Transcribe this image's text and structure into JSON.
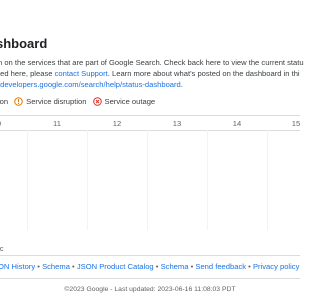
{
  "page": {
    "title": "shboard",
    "intro_line1_prefix": "n on the services that are part of Google Search. Check back here to view the current statu",
    "intro_line2_prefix": "ted here, please ",
    "contact_support_link": "contact Support",
    "intro_line2_suffix": ". Learn more about what's posted on the dashboard in thi",
    "status_dashboard_link": "/developers.google.com/search/help/status-dashboard",
    "intro_line3_suffix": "."
  },
  "legend": {
    "items": [
      {
        "label": "ion",
        "icon": "info-icon",
        "color": "#5f6368"
      },
      {
        "label": "Service disruption",
        "icon": "warning-circle-icon",
        "color": "#e37400"
      },
      {
        "label": "Service outage",
        "icon": "error-x-icon",
        "color": "#d93025"
      }
    ]
  },
  "calendar": {
    "days": [
      "0",
      "11",
      "12",
      "13",
      "14",
      "15"
    ]
  },
  "timezone_label": "fic",
  "footer": {
    "links": [
      "ON History",
      "Schema",
      "JSON Product Catalog",
      "Schema",
      "Send feedback",
      "Privacy policy"
    ],
    "separator": "•"
  },
  "copyright": "©2023 Google - Last updated: 2023-06-16 11:08:03 PDT"
}
